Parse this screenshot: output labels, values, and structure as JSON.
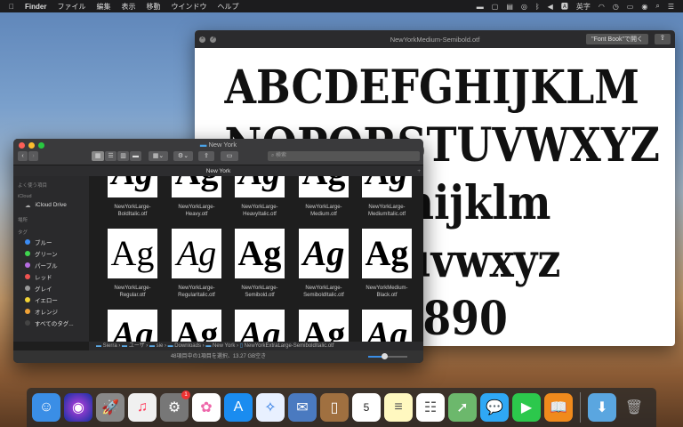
{
  "menubar": {
    "app": "Finder",
    "items": [
      "ファイル",
      "編集",
      "表示",
      "移動",
      "ウインドウ",
      "ヘルプ"
    ],
    "input_mode": "英字"
  },
  "quicklook": {
    "title": "NewYorkMedium-Semibold.otf",
    "open_button": "\"Font Book\"で開く",
    "lines": [
      "ABCDEFGHIJKLM",
      "NOPQRSTUVWXYZ",
      "abcdefghijklm",
      "nopqrstuvwxyz",
      "1234567890"
    ]
  },
  "finder": {
    "title": "New York",
    "tab": "New York",
    "search_placeholder": "検索",
    "sidebar": {
      "favorites": "よく使う項目",
      "icloud": "iCloud",
      "icloud_drive": "iCloud Drive",
      "locations": "場所",
      "tags_header": "タグ",
      "tags": [
        {
          "label": "ブルー",
          "color": "#3b8cf5"
        },
        {
          "label": "グリーン",
          "color": "#3fd44f"
        },
        {
          "label": "パープル",
          "color": "#b56ce0"
        },
        {
          "label": "レッド",
          "color": "#ef5350"
        },
        {
          "label": "グレイ",
          "color": "#9a9a9a"
        },
        {
          "label": "イエロー",
          "color": "#f2d335"
        },
        {
          "label": "オレンジ",
          "color": "#f0a236"
        },
        {
          "label": "すべてのタグ...",
          "color": "#444"
        }
      ]
    },
    "files": [
      {
        "l1": "NewYorkLarge-",
        "l2": "BoldItalic.otf"
      },
      {
        "l1": "NewYorkLarge-",
        "l2": "Heavy.otf"
      },
      {
        "l1": "NewYorkLarge-",
        "l2": "HeavyItalic.otf"
      },
      {
        "l1": "NewYorkLarge-",
        "l2": "Medium.otf"
      },
      {
        "l1": "NewYorkLarge-",
        "l2": "MediumItalic.otf"
      },
      {
        "l1": "NewYorkLarge-",
        "l2": "Regular.otf"
      },
      {
        "l1": "NewYorkLarge-",
        "l2": "RegularItalic.otf"
      },
      {
        "l1": "NewYorkLarge-",
        "l2": "Semibold.otf"
      },
      {
        "l1": "NewYorkLarge-",
        "l2": "SemiboldItalic.otf"
      },
      {
        "l1": "NewYorkMedium-",
        "l2": "Black.otf"
      }
    ],
    "thumb_text": "Ag",
    "path": [
      "Sierra",
      "ユーザ",
      "sie",
      "Downloads",
      "New York",
      "NewYorkExtraLarge-SemiboldItalic.otf"
    ],
    "status": "48項目中の1項目を選択、13.27 GB空き",
    "icon_size": 0.4
  },
  "dock": {
    "badge": "1",
    "calendar_day": "5"
  }
}
